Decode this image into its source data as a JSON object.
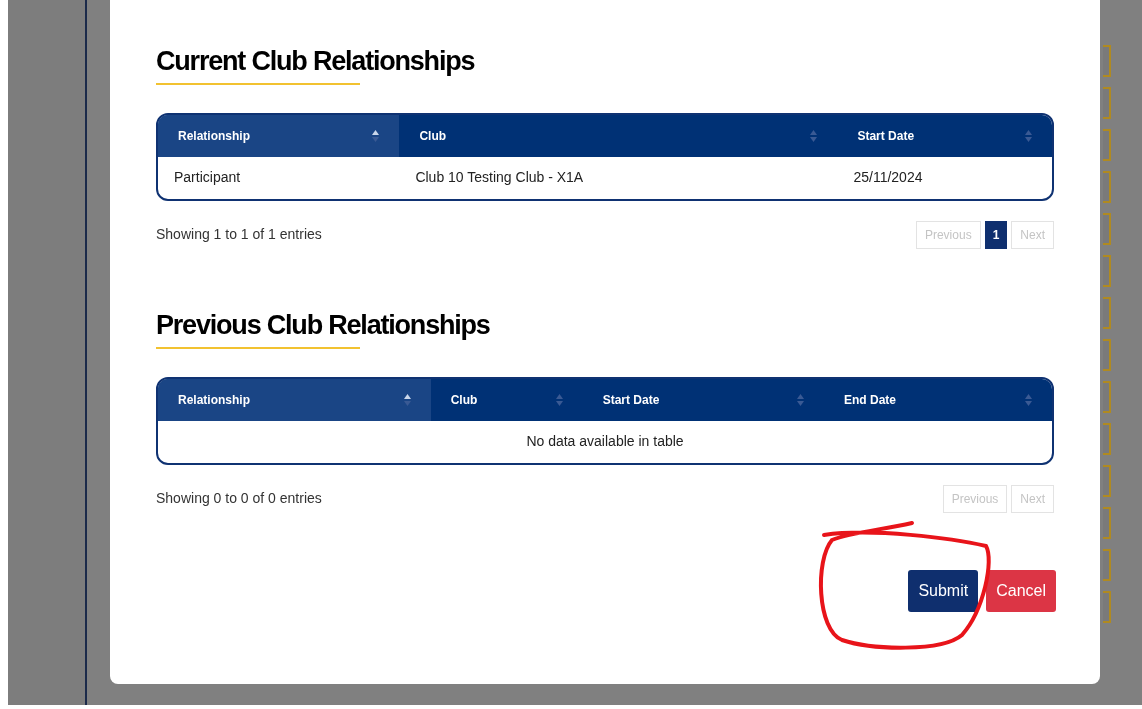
{
  "sections": [
    {
      "title": "Current Club Relationships",
      "columns": [
        {
          "label": "Relationship",
          "sorted": true
        },
        {
          "label": "Club",
          "sorted": false
        },
        {
          "label": "Start Date",
          "sorted": false
        }
      ],
      "rows": [
        [
          "Participant",
          "Club 10 Testing Club - X1A",
          "25/11/2024"
        ]
      ],
      "info": "Showing 1 to 1 of 1 entries",
      "pager": {
        "previous": "Previous",
        "pages": [
          {
            "label": "1",
            "selected": true
          }
        ],
        "next": "Next"
      }
    },
    {
      "title": "Previous Club Relationships",
      "columns": [
        {
          "label": "Relationship",
          "sorted": true
        },
        {
          "label": "Club",
          "sorted": false
        },
        {
          "label": "Start Date",
          "sorted": false
        },
        {
          "label": "End Date",
          "sorted": false
        }
      ],
      "empty_text": "No data available in table",
      "info": "Showing 0 to 0 of 0 entries",
      "pager": {
        "previous": "Previous",
        "next": "Next"
      }
    }
  ],
  "buttons": [
    {
      "label": "Submit",
      "kind": "primary"
    },
    {
      "label": "Cancel",
      "kind": "danger"
    }
  ]
}
